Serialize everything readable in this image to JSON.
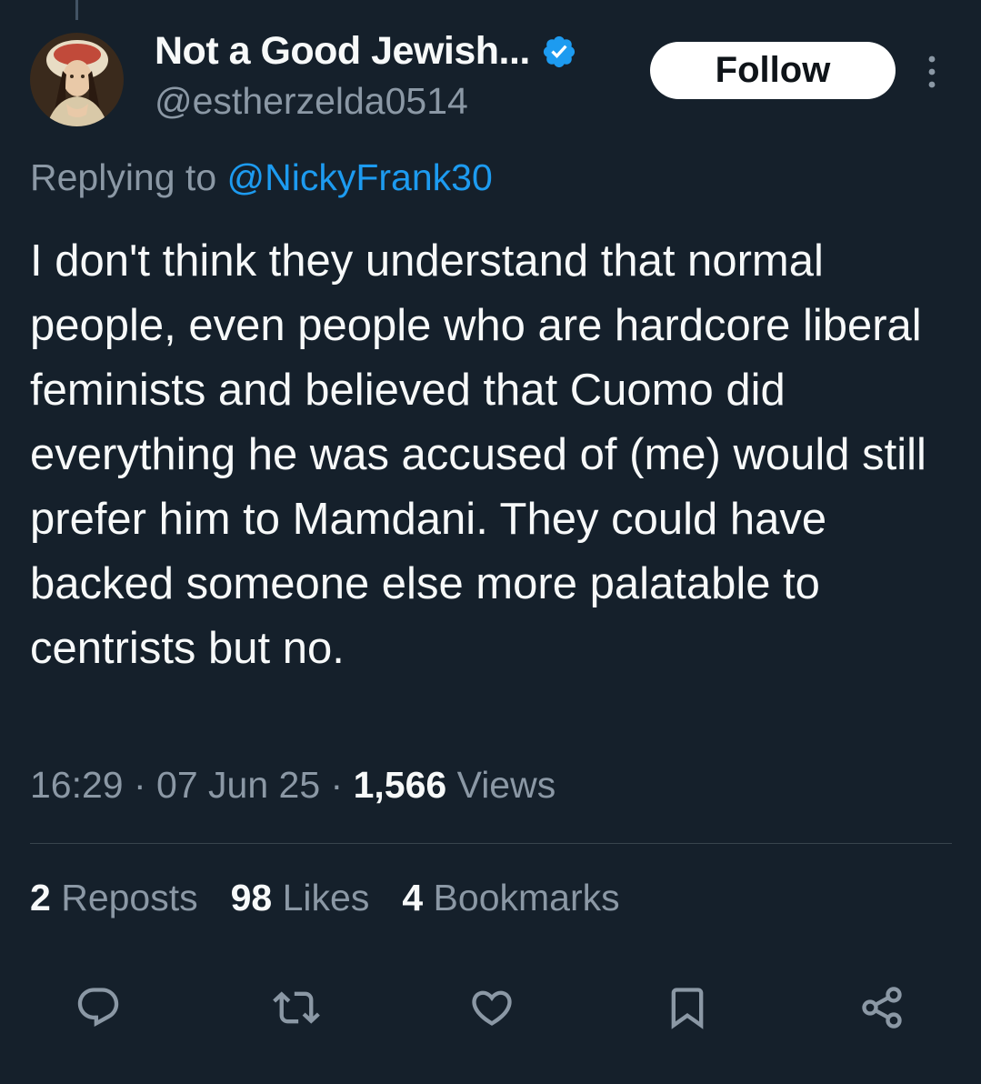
{
  "author": {
    "display_name": "Not a Good Jewish...",
    "handle": "@estherzelda0514",
    "verified_icon": "verified-badge-icon",
    "avatar_icon": "portrait-avatar"
  },
  "follow_label": "Follow",
  "reply": {
    "prefix": "Replying to ",
    "mention": "@NickyFrank30"
  },
  "tweet_text": "I don't think they understand that normal people, even people who are hardcore liberal feminists and believed that Cuomo did everything he was accused of (me) would still prefer him to Mamdani. They could have backed someone else more palatable to centrists but no.",
  "meta": {
    "time": "16:29",
    "separator": " · ",
    "date": "07 Jun 25",
    "views_count": "1,566",
    "views_label": " Views"
  },
  "stats": {
    "reposts_count": "2",
    "reposts_label": " Reposts",
    "likes_count": "98",
    "likes_label": " Likes",
    "bookmarks_count": "4",
    "bookmarks_label": " Bookmarks"
  },
  "actions": [
    "reply-icon",
    "repost-icon",
    "like-icon",
    "bookmark-icon",
    "share-icon"
  ],
  "colors": {
    "background": "#15202b",
    "primary_text": "#f7f9f9",
    "secondary_text": "#8b98a5",
    "accent": "#1d9bf0",
    "divider": "#38444d"
  }
}
